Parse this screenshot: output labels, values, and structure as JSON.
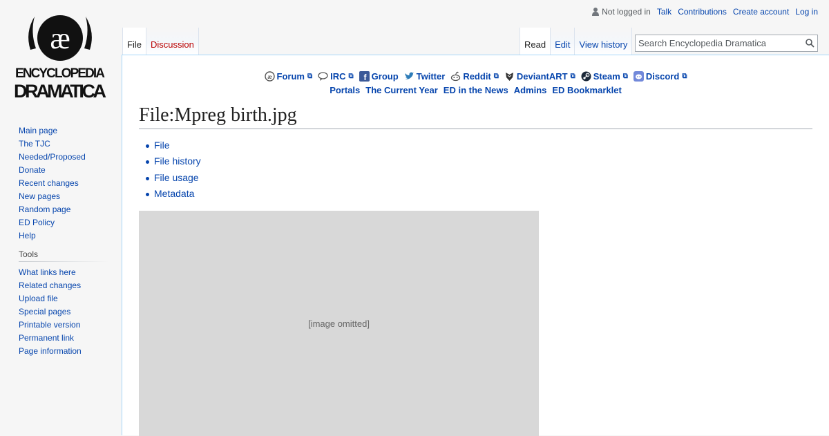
{
  "logo": {
    "top": "ENCYCLOPEDIA",
    "bottom": "DRAMATICA",
    "mark": "æ"
  },
  "personal": {
    "status": "Not logged in",
    "links": [
      "Talk",
      "Contributions",
      "Create account",
      "Log in"
    ]
  },
  "tabs": {
    "left": [
      "File",
      "Discussion"
    ],
    "right": [
      "Read",
      "Edit",
      "View history"
    ]
  },
  "search": {
    "placeholder": "Search Encyclopedia Dramatica"
  },
  "sitenotice": {
    "social": [
      {
        "label": "Forum",
        "icon": "forum-icon"
      },
      {
        "label": "IRC",
        "icon": "irc-icon"
      },
      {
        "label": "Group",
        "icon": "facebook-icon"
      },
      {
        "label": "Twitter",
        "icon": "twitter-icon"
      },
      {
        "label": "Reddit",
        "icon": "reddit-icon"
      },
      {
        "label": "DeviantART",
        "icon": "deviantart-icon"
      },
      {
        "label": "Steam",
        "icon": "steam-icon"
      },
      {
        "label": "Discord",
        "icon": "discord-icon"
      }
    ],
    "links": [
      "Portals",
      "The Current Year",
      "ED in the News",
      "Admins",
      "ED Bookmarklet"
    ]
  },
  "title": "File:Mpreg birth.jpg",
  "filetoc": [
    "File",
    "File history",
    "File usage",
    "Metadata"
  ],
  "sidebar": {
    "navigation": [
      "Main page",
      "The TJC",
      "Needed/Proposed",
      "Donate",
      "Recent changes",
      "New pages",
      "Random page",
      "ED Policy",
      "Help"
    ],
    "tools_heading": "Tools",
    "tools": [
      "What links here",
      "Related changes",
      "Upload file",
      "Special pages",
      "Printable version",
      "Permanent link",
      "Page information"
    ]
  },
  "image": {
    "alt": "[image omitted]"
  },
  "colors": {
    "link": "#0645ad",
    "new_link": "#ba0000",
    "border": "#a7d7f9"
  }
}
